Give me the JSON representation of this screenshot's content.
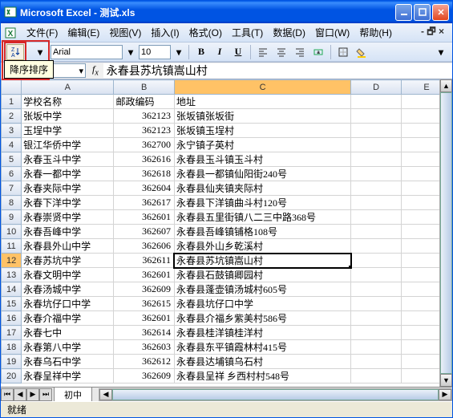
{
  "title": "Microsoft Excel - 测试.xls",
  "menus": [
    "文件(F)",
    "编辑(E)",
    "视图(V)",
    "插入(I)",
    "格式(O)",
    "工具(T)",
    "数据(D)",
    "窗口(W)",
    "帮助(H)"
  ],
  "tooltip": "降序排序",
  "font_name": "Arial",
  "font_size": "10",
  "name_box": "",
  "formula_value": "永春县苏坑镇嵩山村",
  "columns": [
    "A",
    "B",
    "C",
    "D",
    "E"
  ],
  "header_row": {
    "a": "学校名称",
    "b": "邮政编码",
    "c": "地址"
  },
  "rows": [
    {
      "a": "张坂中学",
      "b": "362123",
      "c": "张坂镇张坂街"
    },
    {
      "a": "玉埕中学",
      "b": "362123",
      "c": "张坂镇玉埕村"
    },
    {
      "a": "银江华侨中学",
      "b": "362700",
      "c": "永宁镇子英村"
    },
    {
      "a": "永春玉斗中学",
      "b": "362616",
      "c": "永春县玉斗镇玉斗村"
    },
    {
      "a": "永春一都中学",
      "b": "362618",
      "c": "永春县一都镇仙阳街240号"
    },
    {
      "a": "永春夹际中学",
      "b": "362604",
      "c": "永春县仙夹镇夹际村"
    },
    {
      "a": "永春下洋中学",
      "b": "362617",
      "c": "永春县下洋镇曲斗村120号"
    },
    {
      "a": "永春崇贤中学",
      "b": "362601",
      "c": "永春县五里街镇八二三中路368号"
    },
    {
      "a": "永春吾峰中学",
      "b": "362607",
      "c": "永春县吾峰镇铺格108号"
    },
    {
      "a": "永春县外山中学",
      "b": "362606",
      "c": "永春县外山乡乾溪村"
    },
    {
      "a": "永春苏坑中学",
      "b": "362611",
      "c": "永春县苏坑镇嵩山村"
    },
    {
      "a": "永春文明中学",
      "b": "362601",
      "c": "永春县石鼓镇卿园村"
    },
    {
      "a": "永春汤城中学",
      "b": "362609",
      "c": "永春县蓬壶镇汤城村605号"
    },
    {
      "a": "永春坑仔口中学",
      "b": "362615",
      "c": "永春县坑仔口中学"
    },
    {
      "a": "永春介福中学",
      "b": "362601",
      "c": "永春县介福乡紫美村586号"
    },
    {
      "a": "永春七中",
      "b": "362614",
      "c": "永春县桂洋镇桂洋村"
    },
    {
      "a": "永春第八中学",
      "b": "362603",
      "c": "永春县东平镇霞林村415号"
    },
    {
      "a": "永春乌石中学",
      "b": "362612",
      "c": "永春县达埔镇乌石村"
    },
    {
      "a": "永春呈祥中学",
      "b": "362609",
      "c": "永春县呈祥 乡西村村548号"
    }
  ],
  "row_count": 20,
  "selected_row": 12,
  "selected_col": "C",
  "sheet_tab": "初中",
  "status": "就绪"
}
